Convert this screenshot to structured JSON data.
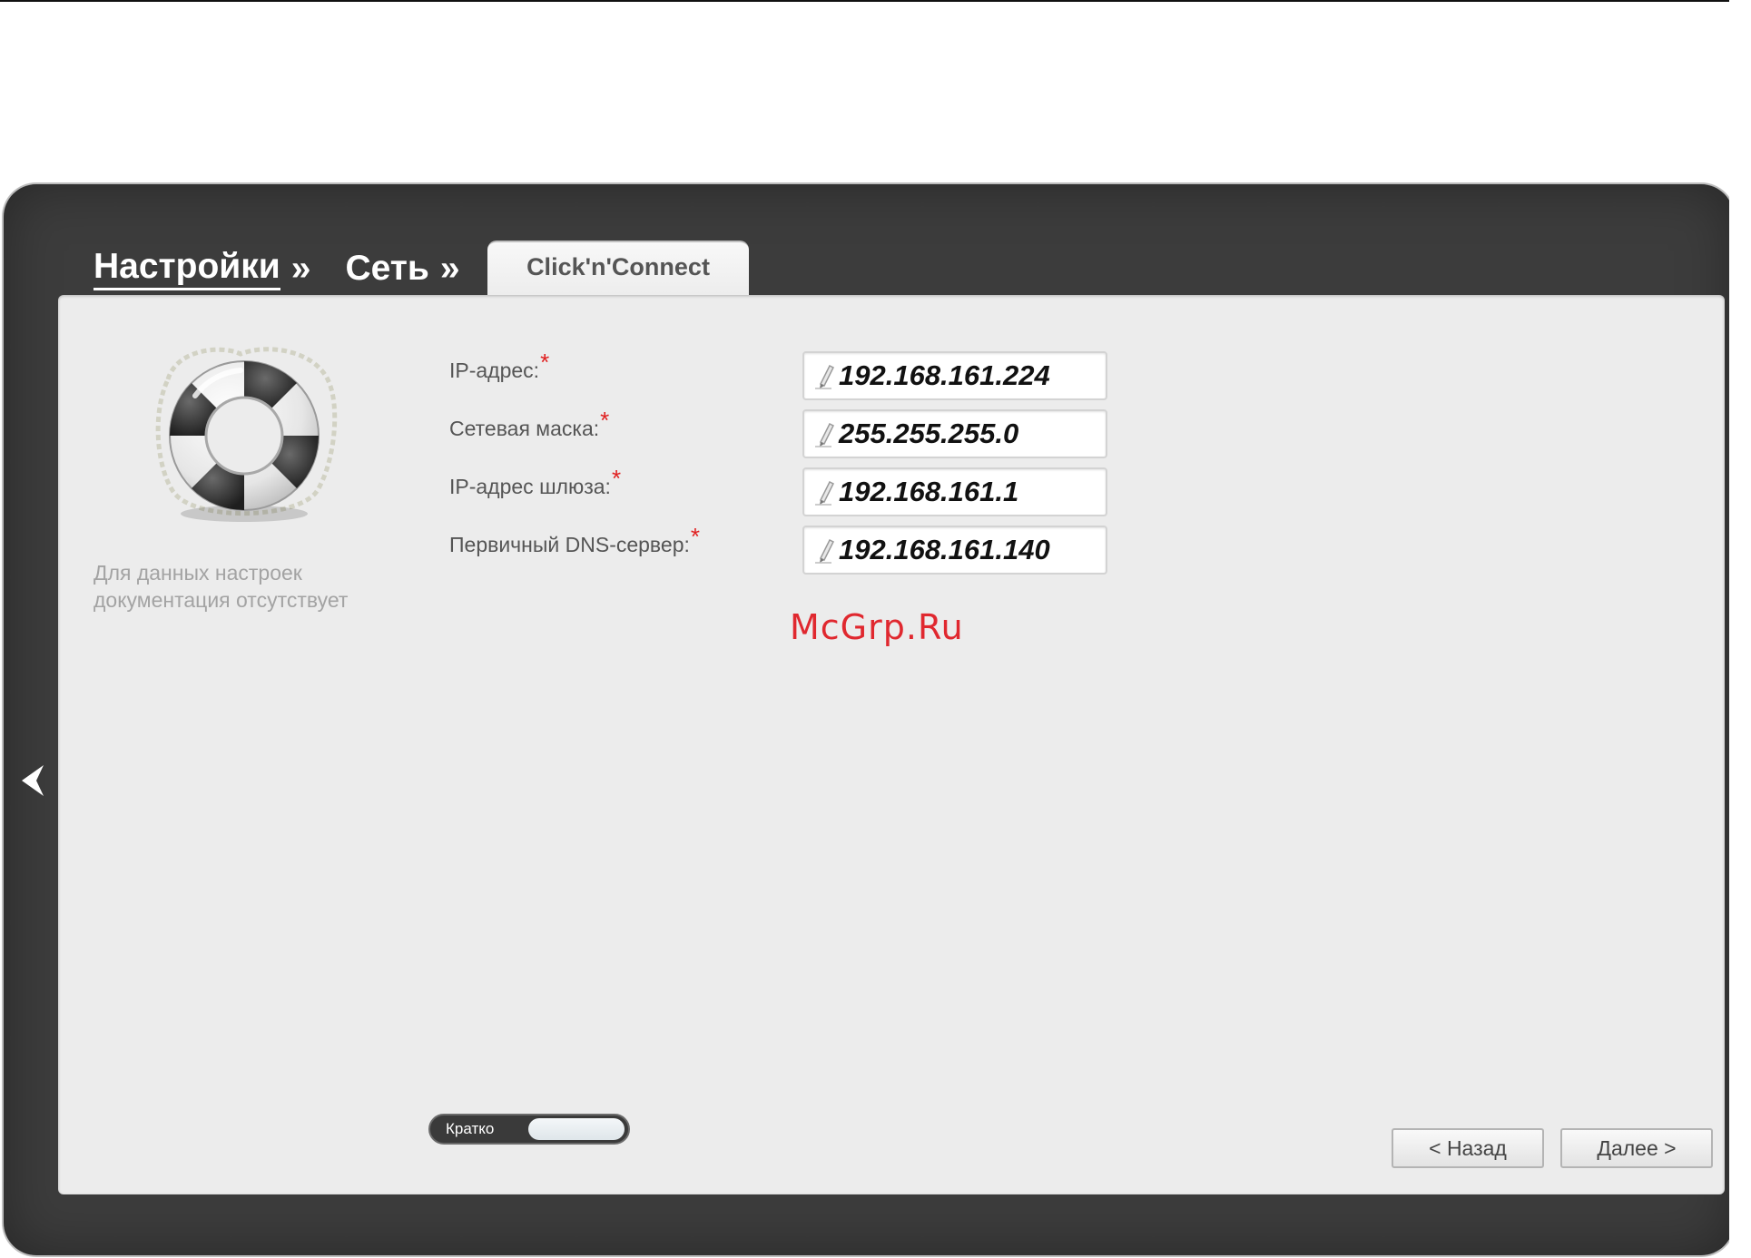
{
  "breadcrumb": {
    "level1": "Настройки",
    "level2": "Сеть",
    "separator": "»"
  },
  "tab": {
    "label": "Click'n'Connect"
  },
  "help": {
    "icon": "lifebuoy-icon",
    "note": "Для данных настроек документация отсутствует"
  },
  "form": {
    "required_marker": "*",
    "fields": [
      {
        "label": "IP-адрес:",
        "value": "192.168.161.224"
      },
      {
        "label": "Сетевая маска:",
        "value": "255.255.255.0"
      },
      {
        "label": "IP-адрес шлюза:",
        "value": "192.168.161.1"
      },
      {
        "label": "Первичный DNS-сервер:",
        "value": "192.168.161.140"
      }
    ]
  },
  "watermark": "McGrp.Ru",
  "view_toggle": {
    "label": "Кратко"
  },
  "buttons": {
    "back": "< Назад",
    "next": "Далее >"
  },
  "colors": {
    "frame": "#3c3c3c",
    "panel": "#ececec",
    "required": "#e02020",
    "watermark": "#e0282f"
  }
}
